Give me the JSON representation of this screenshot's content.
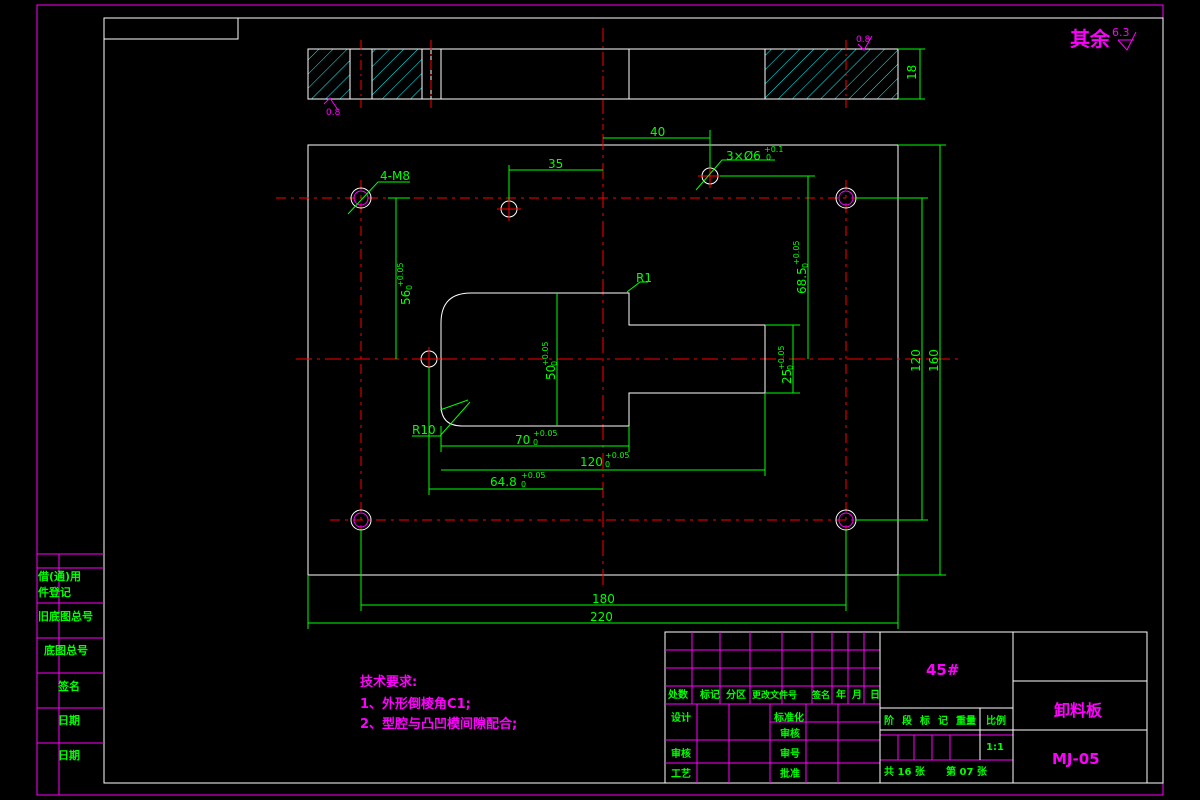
{
  "roughness": {
    "label": "其余",
    "value": "6.3"
  },
  "roughness_small": {
    "top": "0.8",
    "bottom": "0.8"
  },
  "section": {
    "thickness": "18"
  },
  "dims": {
    "d40": "40",
    "d35": "35",
    "d4m8": "4-M8",
    "d3x6": "3×Ø6",
    "d3x6_tol": "+0.1",
    "d3x6_low": "0",
    "d56": "56",
    "d56_tol": "+0.05",
    "d56_low": "0",
    "d685": "68.5",
    "d685_tol": "+0.05",
    "d685_low": "0",
    "d50": "50",
    "d50_tol": "+0.05",
    "d50_low": "0",
    "d25": "25",
    "d25_tol": "+0.05",
    "d25_low": "0",
    "r1": "R1",
    "r10": "R10",
    "d70": "70",
    "d70_tol": "+0.05",
    "d70_low": "0",
    "d120h": "120",
    "d120h_tol": "+0.05",
    "d120h_low": "0",
    "d648": "64.8",
    "d648_tol": "+0.05",
    "d648_low": "0",
    "d120v": "120",
    "d160": "160",
    "d180": "180",
    "d220": "220"
  },
  "left_strip": [
    "借(通)用",
    "件登记",
    "旧底图总号",
    "底图总号",
    "签名",
    "日期",
    "日期"
  ],
  "tech": {
    "title": "技术要求:",
    "items": [
      "1、外形倒棱角C1;",
      "2、型腔与凸凹模间隙配合;"
    ]
  },
  "title_block": {
    "material": "45#",
    "part_name": "卸料板",
    "drawing_no": "MJ-05",
    "rev_header": [
      "标记",
      "处数",
      "分区",
      "更改文件号",
      "签名",
      "年",
      "月",
      "日"
    ],
    "roles_left": [
      "设计",
      "审核",
      "工艺"
    ],
    "roles_mid": [
      "标准化",
      "审核",
      "审号",
      "批准"
    ],
    "stage_header": [
      "阶",
      "段",
      "标",
      "记",
      "重量",
      "比例"
    ],
    "scale": "1:1",
    "sheets_total": "共 16 张",
    "sheet_no": "第 07 张"
  }
}
